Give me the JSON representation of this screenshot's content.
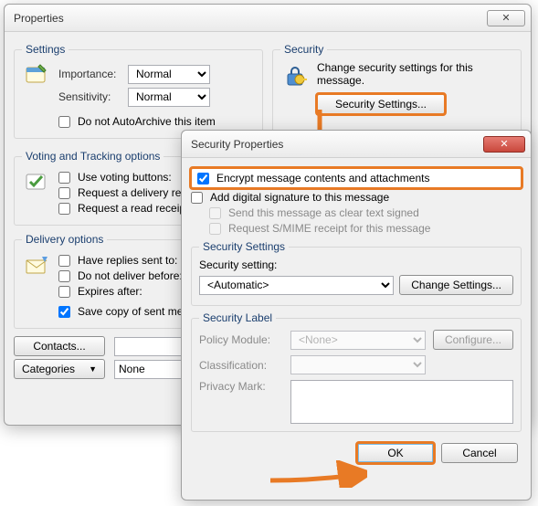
{
  "props": {
    "title": "Properties",
    "settings": {
      "legend": "Settings",
      "importance_lbl": "Importance:",
      "importance_val": "Normal",
      "sensitivity_lbl": "Sensitivity:",
      "sensitivity_val": "Normal",
      "autoarchive_lbl": "Do not AutoArchive this item"
    },
    "security": {
      "legend": "Security",
      "desc": "Change security settings for this message.",
      "button": "Security Settings..."
    },
    "voting": {
      "legend": "Voting and Tracking options",
      "use_voting_lbl": "Use voting buttons:",
      "delivery_receipt_lbl": "Request a delivery rec",
      "read_receipt_lbl": "Request a read receip"
    },
    "delivery": {
      "legend": "Delivery options",
      "replies_lbl": "Have replies sent to:",
      "nodeliver_lbl": "Do not deliver before:",
      "expires_lbl": "Expires after:",
      "savecopy_lbl": "Save copy of sent mes"
    },
    "contacts_btn": "Contacts...",
    "categories_btn": "Categories",
    "categories_val": "None"
  },
  "sec": {
    "title": "Security Properties",
    "encrypt_lbl": "Encrypt message contents and attachments",
    "sign_lbl": "Add digital signature to this message",
    "cleartext_lbl": "Send this message as clear text signed",
    "smime_lbl": "Request S/MIME receipt for this message",
    "settings": {
      "legend": "Security Settings",
      "setting_lbl": "Security setting:",
      "setting_val": "<Automatic>",
      "change_btn": "Change Settings..."
    },
    "label": {
      "legend": "Security Label",
      "policy_lbl": "Policy Module:",
      "policy_val": "<None>",
      "config_btn": "Configure...",
      "class_lbl": "Classification:",
      "privacy_lbl": "Privacy Mark:"
    },
    "ok": "OK",
    "cancel": "Cancel"
  }
}
